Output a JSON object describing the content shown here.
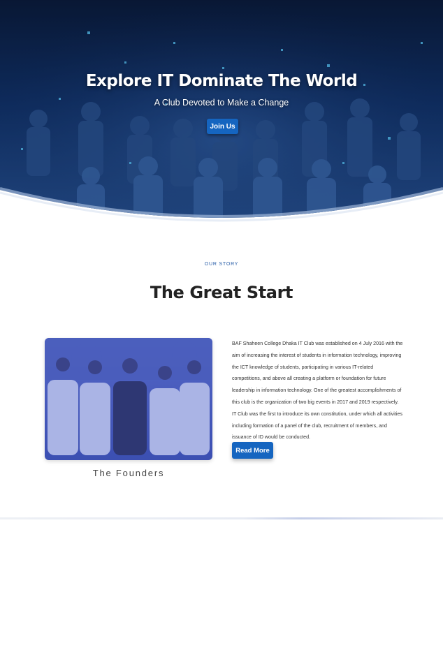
{
  "hero": {
    "title": "Explore IT Dominate The World",
    "subtitle": "A Club Devoted to Make a Change",
    "cta_label": "Join Us"
  },
  "story": {
    "eyebrow": "OUR STORY",
    "title": "The Great Start",
    "photo_caption": "The Founders",
    "paragraph": "BAF Shaheen College Dhaka IT Club was established on 4 July 2016 with the aim of increasing the interest of students in information technology, improving the ICT knowledge of students, participating in various IT-related competitions, and above all creating a platform or foundation for future leadership in information technology. One of the greatest accomplishments of this club is the organization of two big events in 2017 and 2019 respectively. IT Club was the first to introduce its own constitution, under which all activities including formation of a panel of the club, recruitment of members, and issuance of ID would be conducted.",
    "read_more_label": "Read More"
  },
  "colors": {
    "primary": "#1565c0",
    "hero_overlay": "#0b2a5c",
    "eyebrow": "#2a5fa8"
  }
}
